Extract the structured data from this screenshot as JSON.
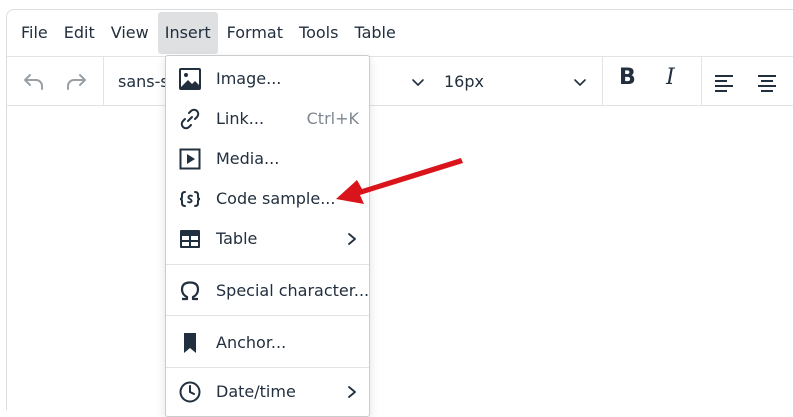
{
  "menubar": {
    "items": [
      {
        "label": "File"
      },
      {
        "label": "Edit"
      },
      {
        "label": "View"
      },
      {
        "label": "Insert",
        "active": true
      },
      {
        "label": "Format"
      },
      {
        "label": "Tools"
      },
      {
        "label": "Table"
      }
    ]
  },
  "toolbar": {
    "font_family": "sans-serif",
    "font_size": "16px",
    "bold_label": "B",
    "italic_label": "I"
  },
  "insert_menu": {
    "items": [
      {
        "label": "Image...",
        "icon": "image-icon"
      },
      {
        "label": "Link...",
        "shortcut": "Ctrl+K",
        "icon": "link-icon"
      },
      {
        "label": "Media...",
        "icon": "media-icon"
      },
      {
        "label": "Code sample...",
        "icon": "code-sample-icon"
      },
      {
        "label": "Table",
        "icon": "table-icon",
        "submenu": true
      },
      {
        "label": "Special character...",
        "icon": "omega-icon"
      },
      {
        "label": "Anchor...",
        "icon": "bookmark-icon"
      },
      {
        "label": "Date/time",
        "icon": "clock-icon",
        "submenu": true
      }
    ]
  },
  "colors": {
    "text": "#222f3e",
    "border": "#e3e3e3",
    "menu_active_bg": "#dee0e2",
    "annotation_arrow": "#d9141a"
  }
}
